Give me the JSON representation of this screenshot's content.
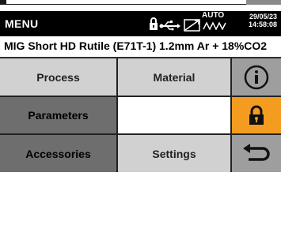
{
  "header": {
    "title": "MENU",
    "mode": "AUTO",
    "date": "29/05/23",
    "time": "14:58:08"
  },
  "info": {
    "process_line": "MIG Short HD  Rutile (E71T-1)  1.2mm  Ar + 18%CO2"
  },
  "menu": {
    "process": "Process",
    "material": "Material",
    "parameters": "Parameters",
    "accessories": "Accessories",
    "settings": "Settings"
  },
  "colors": {
    "header_bg": "#000000",
    "button_light": "#d1d1d1",
    "button_dark": "#6e6e6e",
    "lock_active": "#f39c1f",
    "icon_panel": "#9e9e9e"
  },
  "icons": [
    "lock-icon",
    "usb-icon",
    "arc-waveform-icon",
    "auto-wave-icon",
    "info-icon",
    "padlock-icon",
    "back-arrow-icon"
  ]
}
